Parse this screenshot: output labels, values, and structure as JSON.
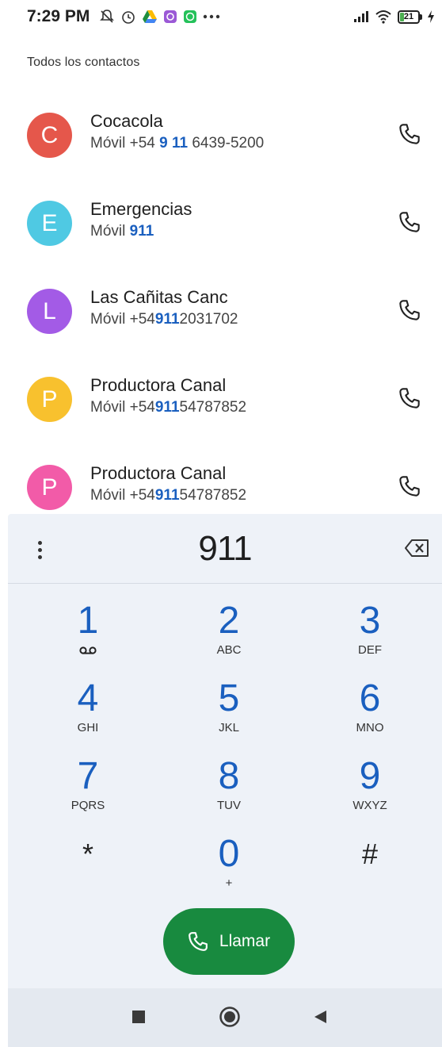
{
  "status_bar": {
    "time": "7:29 PM",
    "battery_level": "21",
    "icons": [
      "muted-bell-icon",
      "alarm-icon",
      "drive-icon",
      "app-icon",
      "whatsapp-icon",
      "more-notifications-icon",
      "signal-icon",
      "wifi-icon",
      "battery-icon",
      "charging-icon"
    ]
  },
  "contacts": {
    "header": "Todos los contactos",
    "items": [
      {
        "initial": "C",
        "name": "Cocacola",
        "label": "Móvil",
        "number_pre": "+54 ",
        "number_match": "9 11",
        "number_post": " 6439-5200",
        "color": "#e5574b"
      },
      {
        "initial": "E",
        "name": "Emergencias",
        "label": "Móvil",
        "number_pre": "",
        "number_match": "911",
        "number_post": "",
        "color": "#4fc9e3"
      },
      {
        "initial": "L",
        "name": "Las Cañitas Canc",
        "label": "Móvil",
        "number_pre": "+54",
        "number_match": "911",
        "number_post": "2031702",
        "color": "#a35be6"
      },
      {
        "initial": "P",
        "name": "Productora Canal",
        "label": "Móvil",
        "number_pre": "+54",
        "number_match": "911",
        "number_post": "54787852",
        "color": "#f8c12e"
      },
      {
        "initial": "P",
        "name": "Productora Canal",
        "label": "Móvil",
        "number_pre": "+54",
        "number_match": "911",
        "number_post": "54787852",
        "color": "#f25ba8"
      }
    ]
  },
  "dialer": {
    "dialed_number": "911",
    "keys": [
      {
        "digit": "1",
        "letters": ""
      },
      {
        "digit": "2",
        "letters": "ABC"
      },
      {
        "digit": "3",
        "letters": "DEF"
      },
      {
        "digit": "4",
        "letters": "GHI"
      },
      {
        "digit": "5",
        "letters": "JKL"
      },
      {
        "digit": "6",
        "letters": "MNO"
      },
      {
        "digit": "7",
        "letters": "PQRS"
      },
      {
        "digit": "8",
        "letters": "TUV"
      },
      {
        "digit": "9",
        "letters": "WXYZ"
      },
      {
        "digit": "*",
        "letters": ""
      },
      {
        "digit": "0",
        "letters": "+"
      },
      {
        "digit": "#",
        "letters": ""
      }
    ],
    "call_label": "Llamar"
  },
  "colors": {
    "accent": "#1a5fbf",
    "call_button": "#188a3f",
    "dialer_bg": "#eef2f8"
  }
}
